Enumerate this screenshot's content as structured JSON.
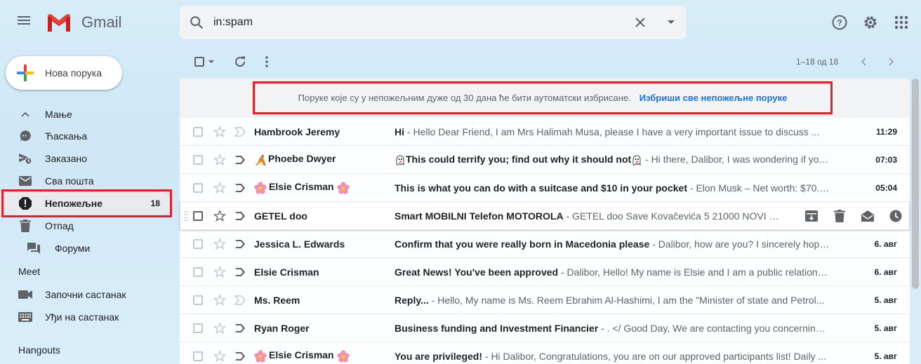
{
  "app": {
    "name": "Gmail"
  },
  "search": {
    "value": "in:spam"
  },
  "compose": {
    "label": "Нова порука"
  },
  "sidebar": {
    "items": [
      {
        "label": "Мање",
        "icon": "chevron-up-icon"
      },
      {
        "label": "Ћаскања",
        "icon": "chat-icon"
      },
      {
        "label": "Заказано",
        "icon": "scheduled-send-icon"
      },
      {
        "label": "Сва пошта",
        "icon": "mail-icon"
      },
      {
        "label": "Непожељне",
        "icon": "spam-report-icon",
        "count": "18"
      },
      {
        "label": "Отпад",
        "icon": "trash-icon"
      },
      {
        "label": "Форуми",
        "icon": "forum-icon"
      }
    ],
    "meet": {
      "title": "Meet",
      "items": [
        {
          "label": "Започни састанак",
          "icon": "video-camera-icon"
        },
        {
          "label": "Уђи на састанак",
          "icon": "keyboard-icon"
        }
      ]
    },
    "hangouts": {
      "title": "Hangouts"
    }
  },
  "toolbar": {
    "pager": "1–18 од 18"
  },
  "banner": {
    "text": "Поруке које су у непожељним дуже од 30 дана ће бити аутоматски избрисане.",
    "link": "Избриши све непожељне поруке"
  },
  "emails": [
    {
      "sender": "Hambrook Jeremy",
      "subject": "Hi",
      "snippet": " - Hello Dear Friend, I am Mrs Halimah Musa, please I have a very important issue to discuss ...",
      "date": "11:29",
      "important": false
    },
    {
      "sender": "Phoebe Dwyer",
      "subject": "This could terrify you; find out why it should not",
      "snippet": " - Hi there, Dalibor, I was wondering if you...",
      "date": "07:03",
      "important": true
    },
    {
      "sender": "Elsie Crisman",
      "subject": "This is what you can do with a suitcase and $10 in your pocket",
      "snippet": " - Elon Musk – Net worth: $70.8 ...",
      "date": "05:04",
      "important": true
    },
    {
      "sender": "GETEL doo",
      "subject": "Smart MOBILNI Telefon MOTOROLA",
      "snippet": " - GETEL doo Save Kovačevića 5 21000 NOVI SA...",
      "date": "",
      "important": true
    },
    {
      "sender": "Jessica L. Edwards",
      "subject": "Confirm that you were really born in Macedonia please",
      "snippet": " - Dalibor, how are you? I sincerely hope t...",
      "date": "6. авг",
      "important": true
    },
    {
      "sender": "Elsie Crisman",
      "subject": "Great News! You've been approved",
      "snippet": " - Dalibor, Hello! My name is Elsie and I am a public relations ...",
      "date": "6. авг",
      "important": true
    },
    {
      "sender": "Ms. Reem",
      "subject": "Reply...",
      "snippet": " - Hello, My name is Ms. Reem Ebrahim Al-Hashimi, I am the \"Minister of state and Petrol...",
      "date": "5. авг",
      "important": false
    },
    {
      "sender": "Ryan Roger",
      "subject": "Business funding and Investment Financier",
      "snippet": " - . </ Good Day, We are contacting you concerning f...",
      "date": "5. авг",
      "important": true
    },
    {
      "sender": "Elsie Crisman",
      "subject": "You are privileged!",
      "snippet": " - Hi Dalibor, Congratulations, you are on our approved participants list! Daily ...",
      "date": "5. авг",
      "important": true
    }
  ]
}
